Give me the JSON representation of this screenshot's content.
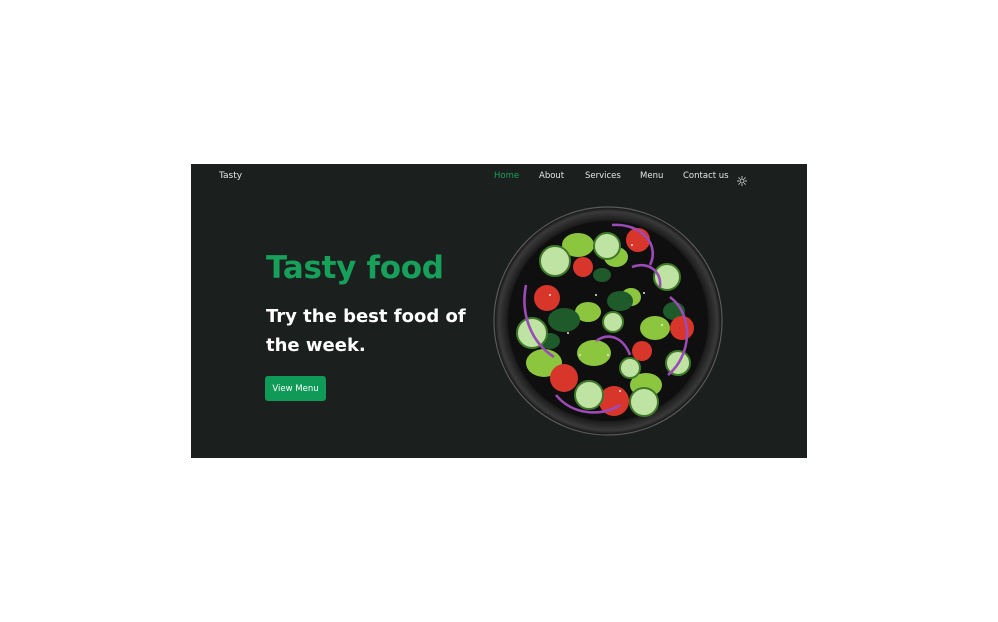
{
  "header": {
    "logo": "Tasty",
    "nav": [
      {
        "label": "Home",
        "active": true
      },
      {
        "label": "About",
        "active": false
      },
      {
        "label": "Services",
        "active": false
      },
      {
        "label": "Menu",
        "active": false
      },
      {
        "label": "Contact us",
        "active": false
      }
    ],
    "theme_icon": "sun-icon"
  },
  "hero": {
    "title": "Tasty food",
    "subtitle": "Try the best food of the week.",
    "button": "View Menu",
    "image_icon": "salad-bowl-image"
  },
  "colors": {
    "background": "#1b201f",
    "accent": "#17a05a",
    "button": "#0f9a57",
    "text": "#ffffff"
  }
}
